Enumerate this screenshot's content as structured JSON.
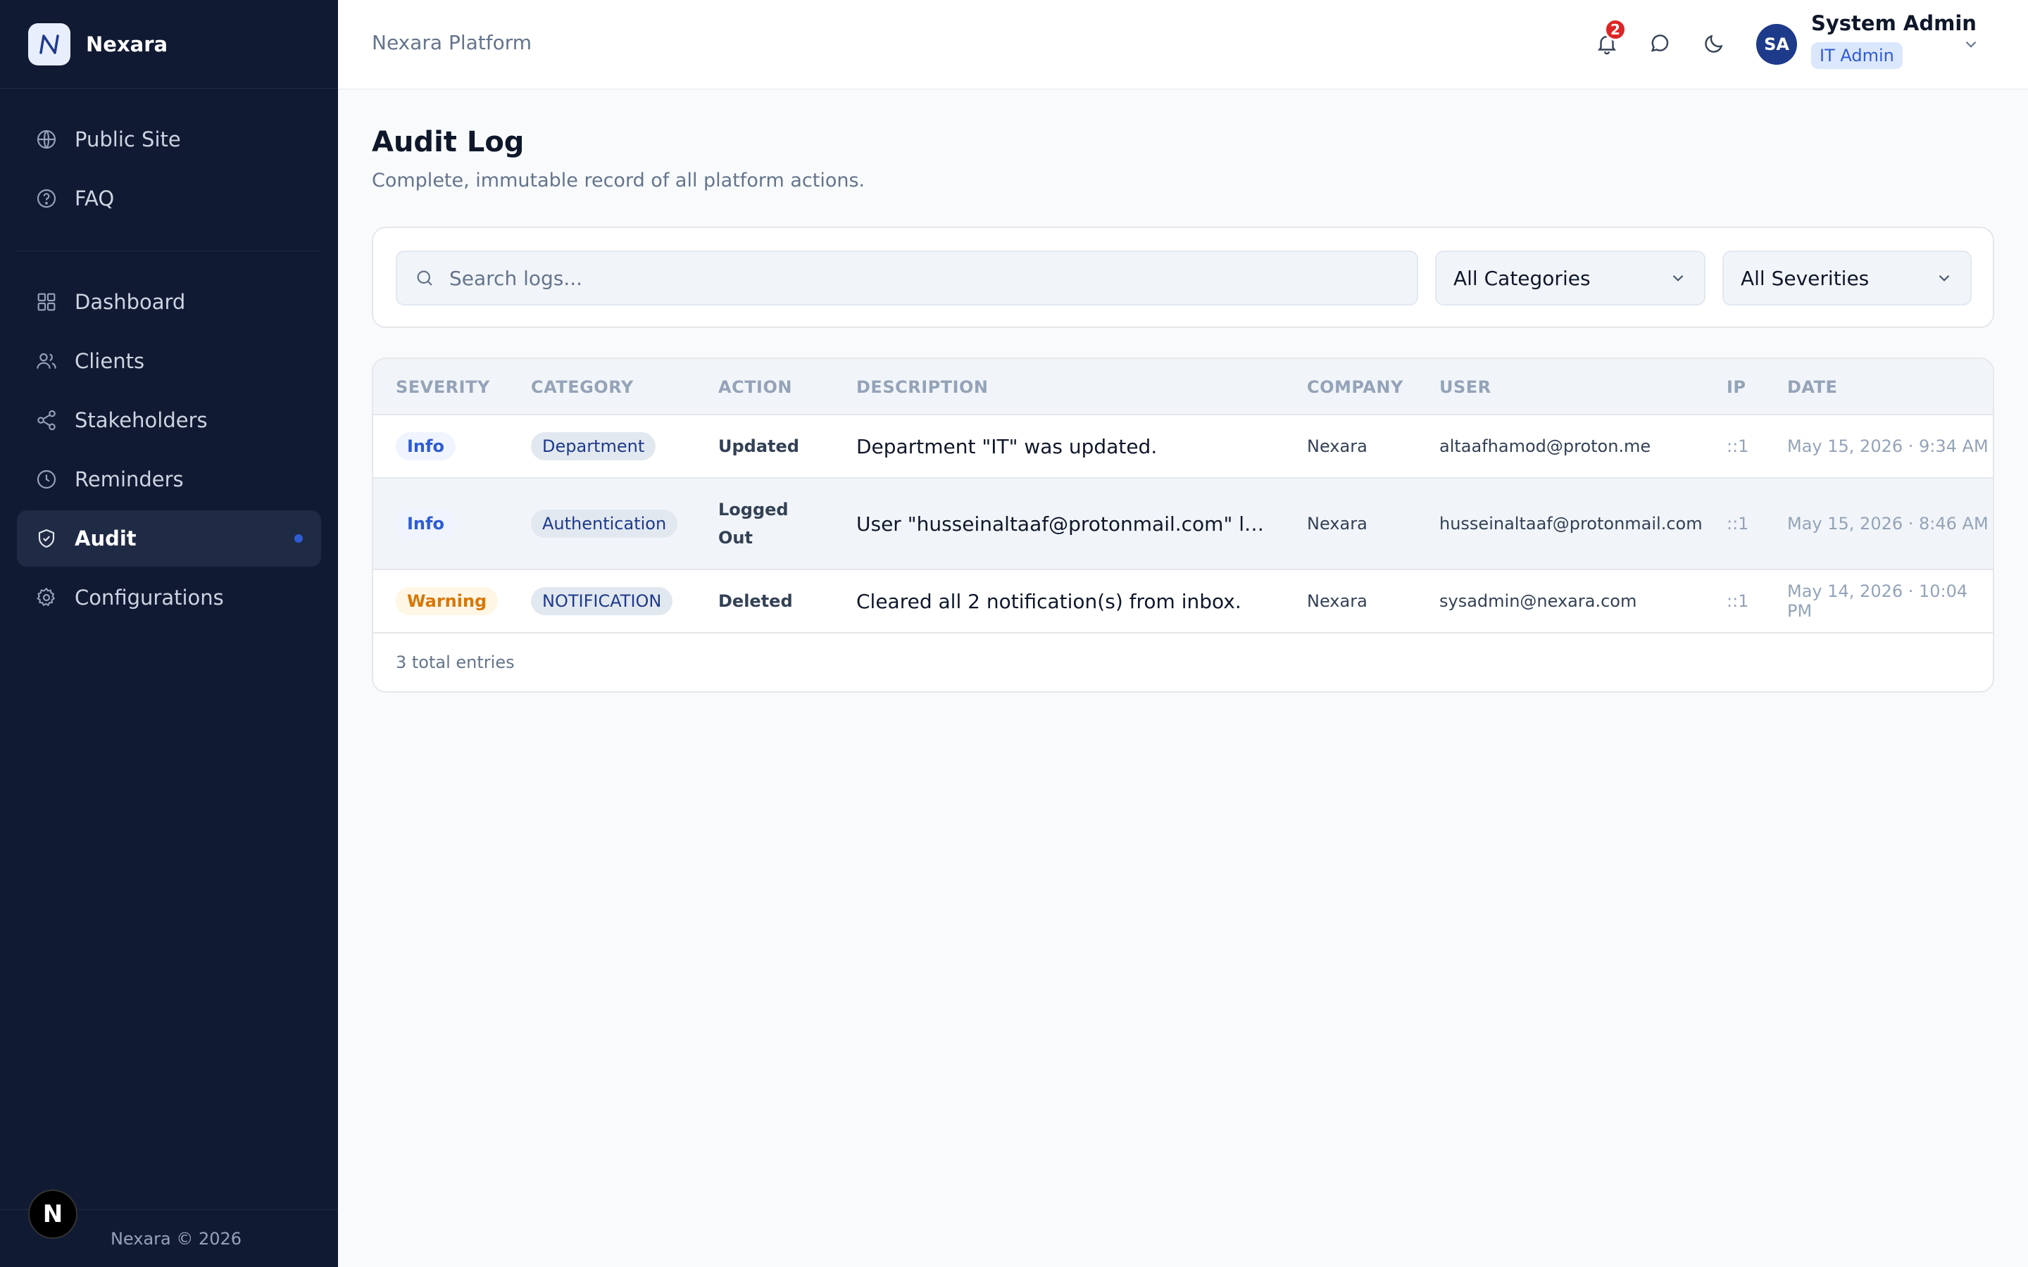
{
  "brand": {
    "name": "Nexara"
  },
  "sidebar": {
    "top_items": [
      {
        "label": "Public Site",
        "icon": "globe-icon"
      },
      {
        "label": "FAQ",
        "icon": "help-circle-icon"
      }
    ],
    "items": [
      {
        "label": "Dashboard",
        "icon": "grid-icon"
      },
      {
        "label": "Clients",
        "icon": "users-icon"
      },
      {
        "label": "Stakeholders",
        "icon": "share-icon"
      },
      {
        "label": "Reminders",
        "icon": "clock-icon"
      },
      {
        "label": "Audit",
        "icon": "shield-check-icon",
        "active": true
      },
      {
        "label": "Configurations",
        "icon": "gear-icon"
      }
    ],
    "footer": "Nexara © 2026",
    "badge": "N"
  },
  "header": {
    "title": "Nexara Platform",
    "notification_count": "2",
    "user": {
      "initials": "SA",
      "name": "System Admin",
      "role": "IT Admin"
    }
  },
  "page": {
    "title": "Audit Log",
    "subtitle": "Complete, immutable record of all platform actions."
  },
  "filters": {
    "search_placeholder": "Search logs...",
    "category": "All Categories",
    "severity": "All Severities"
  },
  "table": {
    "columns": [
      "SEVERITY",
      "CATEGORY",
      "ACTION",
      "DESCRIPTION",
      "COMPANY",
      "USER",
      "IP",
      "DATE"
    ],
    "rows": [
      {
        "severity": "Info",
        "category": "Department",
        "action": "Updated",
        "description": "Department \"IT\" was updated.",
        "company": "Nexara",
        "user": "altaafhamod@proton.me",
        "ip": "::1",
        "date": "May 15, 2026 · 9:34 AM"
      },
      {
        "severity": "Info",
        "category": "Authentication",
        "action": "Logged Out",
        "description": "User \"husseinaltaaf@protonmail.com\" logged out.",
        "company": "Nexara",
        "user": "husseinaltaaf@protonmail.com",
        "ip": "::1",
        "date": "May 15, 2026 · 8:46 AM"
      },
      {
        "severity": "Warning",
        "category": "NOTIFICATION",
        "action": "Deleted",
        "description": "Cleared all 2 notification(s) from inbox.",
        "company": "Nexara",
        "user": "sysadmin@nexara.com",
        "ip": "::1",
        "date": "May 14, 2026 · 10:04 PM"
      }
    ],
    "footer": "3 total entries"
  },
  "colors": {
    "sidebar_bg": "#111a33",
    "accent": "#2f5bd3",
    "notification": "#dc2626",
    "warning": "#d97706"
  }
}
